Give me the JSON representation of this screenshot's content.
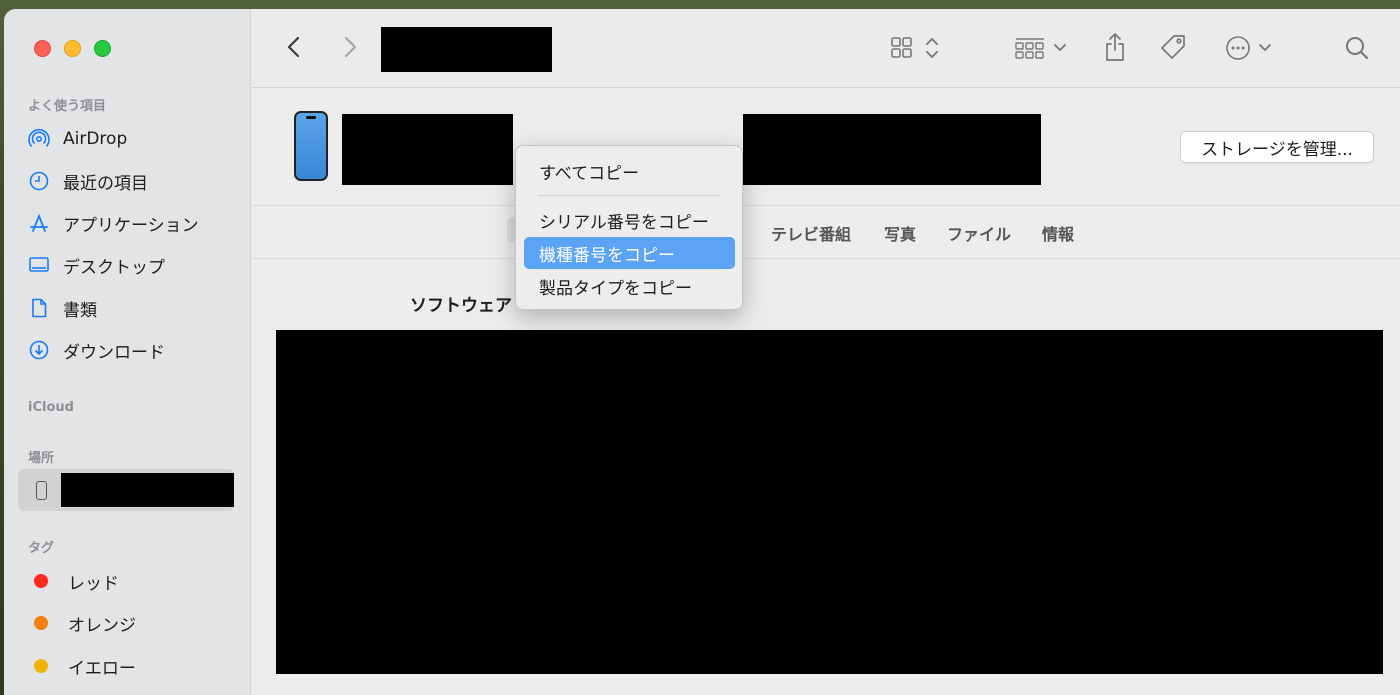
{
  "sidebar": {
    "sections": {
      "favorites": "よく使う項目",
      "icloud": "iCloud",
      "locations": "場所",
      "tags": "タグ"
    },
    "items": [
      {
        "label": "AirDrop",
        "icon": "airdrop-icon"
      },
      {
        "label": "最近の項目",
        "icon": "clock-icon"
      },
      {
        "label": "アプリケーション",
        "icon": "applications-icon"
      },
      {
        "label": "デスクトップ",
        "icon": "desktop-icon"
      },
      {
        "label": "書類",
        "icon": "document-icon"
      },
      {
        "label": "ダウンロード",
        "icon": "download-icon"
      }
    ],
    "tags": [
      {
        "label": "レッド",
        "color": "#ff2a1f"
      },
      {
        "label": "オレンジ",
        "color": "#f5800c"
      },
      {
        "label": "イエロー",
        "color": "#f0b409"
      }
    ]
  },
  "device": {
    "storage_button": "ストレージを管理..."
  },
  "tabs": [
    "テレビ番組",
    "写真",
    "ファイル",
    "情報"
  ],
  "section_title": "ソフトウェア",
  "context_menu": {
    "items": [
      {
        "label": "すべてコピー",
        "highlighted": false
      },
      {
        "label": "シリアル番号をコピー",
        "highlighted": false
      },
      {
        "label": "機種番号をコピー",
        "highlighted": true
      },
      {
        "label": "製品タイプをコピー",
        "highlighted": false
      }
    ]
  },
  "colors": {
    "accent": "#007aff",
    "highlight": "#5ba4f5"
  }
}
